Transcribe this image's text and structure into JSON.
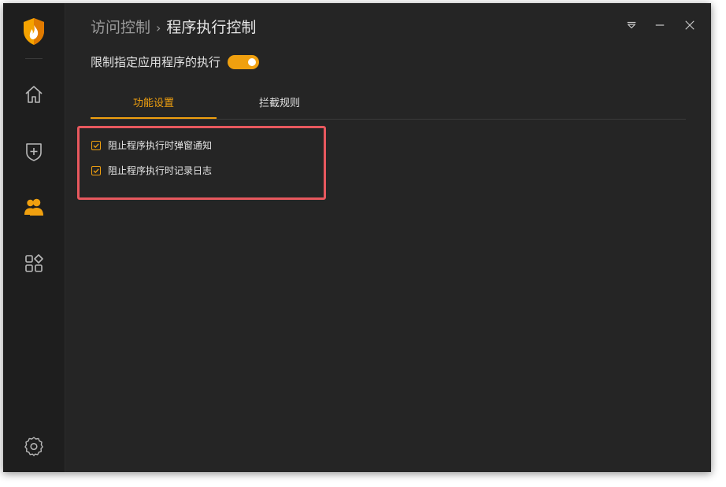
{
  "breadcrumb": {
    "parent": "访问控制",
    "separator": "›",
    "current": "程序执行控制"
  },
  "toggle": {
    "label": "限制指定应用程序的执行",
    "state": "on"
  },
  "tabs": [
    {
      "label": "功能设置",
      "active": true
    },
    {
      "label": "拦截规则",
      "active": false
    }
  ],
  "options": [
    {
      "label": "阻止程序执行时弹窗通知",
      "checked": true
    },
    {
      "label": "阻止程序执行时记录日志",
      "checked": true
    }
  ],
  "sidebar": {
    "items": [
      {
        "icon": "home-icon"
      },
      {
        "icon": "shield-plus-icon"
      },
      {
        "icon": "users-icon",
        "active": true
      },
      {
        "icon": "apps-icon"
      }
    ],
    "bottom_icon": "settings-icon"
  },
  "window_controls": [
    "menu-dropdown-icon",
    "minimize-icon",
    "close-icon"
  ],
  "colors": {
    "accent": "#f0a00f",
    "highlight": "#e8585e",
    "background": "#252525",
    "sidebar": "#1e1e1e"
  }
}
